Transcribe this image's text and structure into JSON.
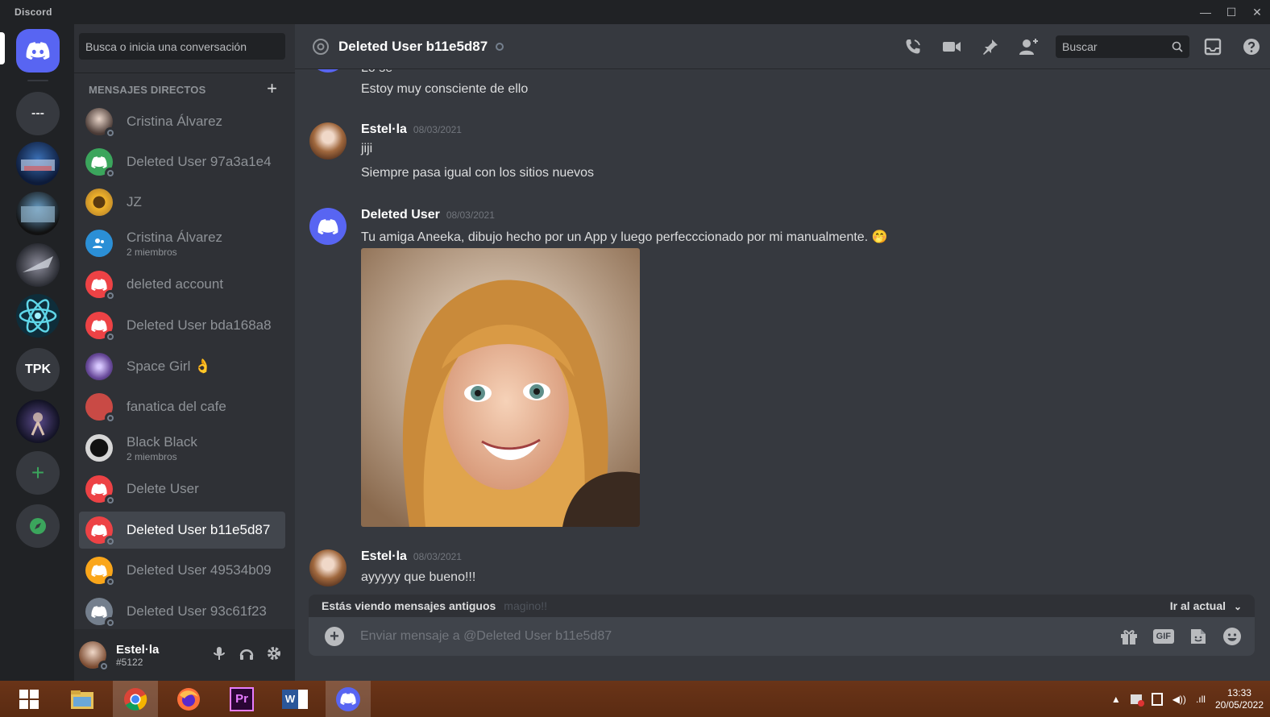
{
  "app": {
    "brand": "Discord"
  },
  "window_controls": {
    "minimize": "—",
    "maximize": "☐",
    "close": "✕"
  },
  "rail": {
    "servers": [
      {
        "label": "",
        "icon": "discord-home-icon"
      },
      {
        "label": "---"
      },
      {
        "label": "",
        "icon": "server-image-1"
      },
      {
        "label": "",
        "icon": "server-image-2"
      },
      {
        "label": "",
        "icon": "server-image-3"
      },
      {
        "label": "",
        "icon": "atom-icon"
      },
      {
        "label": "TPK"
      },
      {
        "label": "",
        "icon": "server-image-4"
      },
      {
        "label": "+",
        "icon": "add-server-icon"
      },
      {
        "label": "",
        "icon": "compass-icon"
      }
    ]
  },
  "dm_sidebar": {
    "search_placeholder": "Busca o inicia una conversación",
    "header": "MENSAJES DIRECTOS",
    "add": "+",
    "items": [
      {
        "name": "Cristina Álvarez",
        "sub": "",
        "color": "#8a6b5a"
      },
      {
        "name": "Deleted User 97a3a1e4",
        "sub": "",
        "color": "#3ba55c"
      },
      {
        "name": "JZ",
        "sub": "",
        "color": "#c8912a"
      },
      {
        "name": "Cristina Álvarez",
        "sub": "2 miembros",
        "color": "#2b8fd6"
      },
      {
        "name": "deleted account",
        "sub": "",
        "color": "#ed4245"
      },
      {
        "name": "Deleted User bda168a8",
        "sub": "",
        "color": "#ed4245"
      },
      {
        "name": "Space Girl 👌",
        "sub": "",
        "color": "#6a4b9c"
      },
      {
        "name": "fanatica del cafe",
        "sub": "",
        "color": "#c94a45"
      },
      {
        "name": "Black Black",
        "sub": "2 miembros",
        "color": "#d7d7d7"
      },
      {
        "name": "Delete User",
        "sub": "",
        "color": "#ed4245"
      },
      {
        "name": "Deleted User b11e5d87",
        "sub": "",
        "color": "#ed4245"
      },
      {
        "name": "Deleted User 49534b09",
        "sub": "",
        "color": "#faa61a"
      },
      {
        "name": "Deleted User 93c61f23",
        "sub": "",
        "color": "#747f8d"
      }
    ]
  },
  "user_panel": {
    "name": "Estel·la",
    "tag": "#5122"
  },
  "chat": {
    "title": "Deleted User b11e5d87",
    "search_placeholder": "Buscar",
    "partial_top": "Lo sé",
    "messages": [
      {
        "author": "",
        "date": "",
        "lines": [
          "Estoy muy consciente de ello"
        ]
      },
      {
        "author": "Estel·la",
        "date": "08/03/2021",
        "lines": [
          "jiji",
          "Siempre pasa igual con los sitios nuevos"
        ]
      },
      {
        "author": "Deleted User",
        "date": "08/03/2021",
        "lines": [
          "Tu amiga Aneeka, dibujo hecho por un App y luego perfecccionado por mi manualmente. 🤭"
        ]
      },
      {
        "author": "Estel·la",
        "date": "08/03/2021",
        "lines": [
          "ayyyyy que bueno!!!"
        ]
      }
    ],
    "old_messages_notice": "Estás viendo mensajes antiguos",
    "old_messages_hidden": "magino!!",
    "jump_label": "Ir al actual",
    "composer_placeholder": "Enviar mensaje a @Deleted User b11e5d87",
    "gif_label": "GIF"
  },
  "colors": {
    "blurple": "#5865f2",
    "rail_bg": "#202225",
    "sidebar_bg": "#2f3136",
    "chat_bg": "#36393f",
    "taskbar": "#5a2b12"
  },
  "taskbar": {
    "apps": [
      "windows-start-icon",
      "file-explorer-icon",
      "chrome-icon",
      "firefox-icon",
      "premiere-icon",
      "word-icon",
      "discord-icon"
    ],
    "premiere_label": "Pr",
    "word_label": "W",
    "time": "13:33",
    "date": "20/05/2022"
  }
}
